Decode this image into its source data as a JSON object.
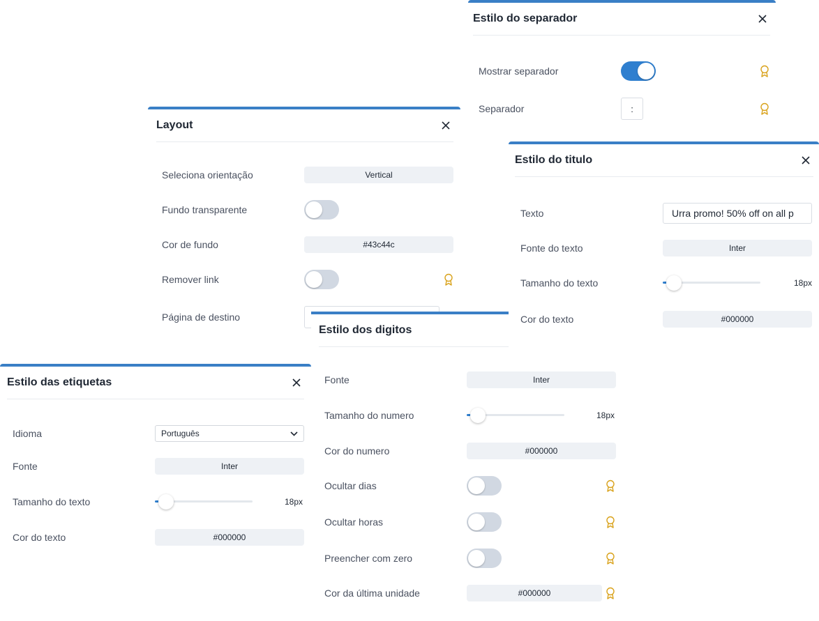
{
  "colors": {
    "accent": "#3a7fc6",
    "toggle_on": "#2f7fcf",
    "toggle_off": "#d1d8e2",
    "field_bg": "#eef1f5",
    "premium_badge": "#d9a21b"
  },
  "separator_panel": {
    "title": "Estilo do separador",
    "show_label": "Mostrar separador",
    "show_on": true,
    "separator_label": "Separador",
    "separator_value": ":"
  },
  "layout_panel": {
    "title": "Layout",
    "orientation_label": "Seleciona orientação",
    "orientation_value": "Vertical",
    "transparent_label": "Fundo transparente",
    "transparent_on": false,
    "bg_label": "Cor de fundo",
    "bg_value": "#43c44c",
    "remove_link_label": "Remover link",
    "remove_link_on": false,
    "dest_label": "Página de destino",
    "dest_value": ""
  },
  "title_panel": {
    "title": "Estilo do titulo",
    "text_label": "Texto",
    "text_value": "Urra promo! 50% off on all p",
    "font_label": "Fonte do texto",
    "font_value": "Inter",
    "size_label": "Tamanho do texto",
    "size_value": "18px",
    "size_fraction": 0.05,
    "color_label": "Cor do texto",
    "color_value": "#000000"
  },
  "digits_panel": {
    "title": "Estilo dos digitos",
    "font_label": "Fonte",
    "font_value": "Inter",
    "size_label": "Tamanho do numero",
    "size_value": "18px",
    "size_fraction": 0.05,
    "color_label": "Cor do numero",
    "color_value": "#000000",
    "hide_days_label": "Ocultar dias",
    "hide_days_on": false,
    "hide_hours_label": "Ocultar horas",
    "hide_hours_on": false,
    "zero_fill_label": "Preencher com zero",
    "zero_fill_on": false,
    "last_unit_label": "Cor da última unidade",
    "last_unit_value": "#000000"
  },
  "labels_panel": {
    "title": "Estilo das etiquetas",
    "language_label": "Idioma",
    "language_value": "Português",
    "font_label": "Fonte",
    "font_value": "Inter",
    "size_label": "Tamanho do texto",
    "size_value": "18px",
    "size_fraction": 0.05,
    "color_label": "Cor do texto",
    "color_value": "#000000"
  }
}
